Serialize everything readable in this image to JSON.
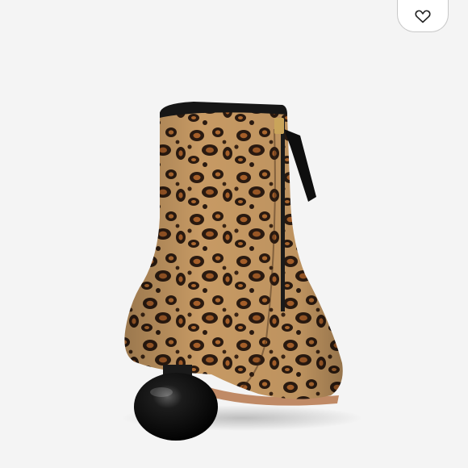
{
  "product": {
    "image_subject": "leopard-print-ankle-boot-with-sphere-heel",
    "colors": {
      "background": "#f4f4f4",
      "fur_base": "#c79a64",
      "spot_dark": "#2a1a10",
      "spot_inner": "#a8602a",
      "heel": "#0d0d0d",
      "sole": "#c08a66"
    }
  },
  "like_button": {
    "icon": "heart-icon"
  }
}
